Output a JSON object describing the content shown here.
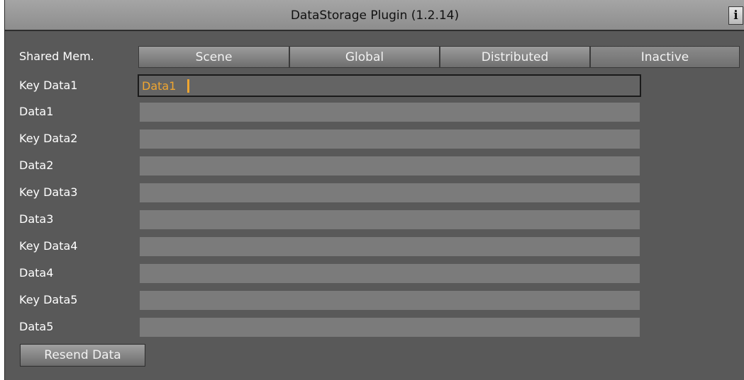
{
  "title_bar": {
    "title": "DataStorage Plugin (1.2.14)",
    "info_label": "i"
  },
  "shared_mem": {
    "label": "Shared Mem.",
    "options": [
      "Scene",
      "Global",
      "Distributed",
      "Inactive"
    ],
    "selected": "Inactive"
  },
  "fields": [
    {
      "label": "Key Data1",
      "value": "Data1"
    },
    {
      "label": "Data1",
      "value": ""
    },
    {
      "label": "Key Data2",
      "value": ""
    },
    {
      "label": "Data2",
      "value": ""
    },
    {
      "label": "Key Data3",
      "value": ""
    },
    {
      "label": "Data3",
      "value": ""
    },
    {
      "label": "Key Data4",
      "value": ""
    },
    {
      "label": "Data4",
      "value": ""
    },
    {
      "label": "Key Data5",
      "value": ""
    },
    {
      "label": "Data5",
      "value": ""
    }
  ],
  "resend_button": "Resend Data",
  "colors": {
    "panel_bg": "#595959",
    "field_bg": "#7b7b7b",
    "input_text": "#f0a630"
  }
}
